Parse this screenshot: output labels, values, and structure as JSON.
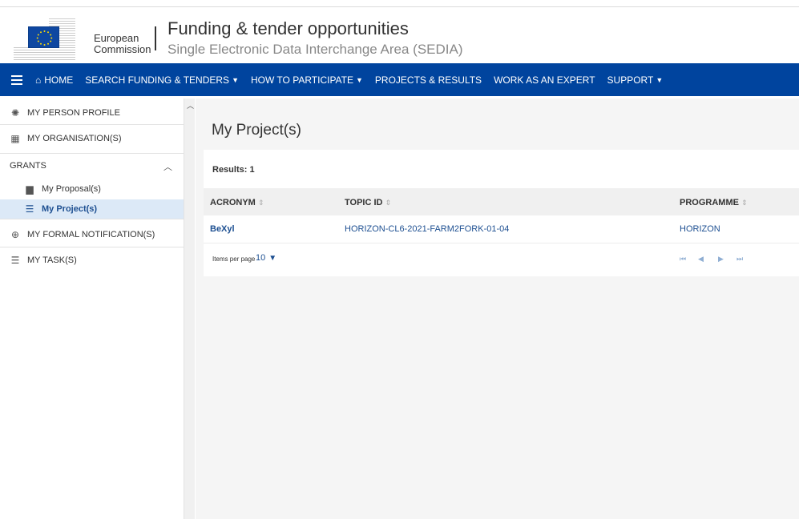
{
  "header": {
    "brand_line1": "European",
    "brand_line2": "Commission",
    "title": "Funding & tender opportunities",
    "subtitle": "Single Electronic Data Interchange Area (SEDIA)"
  },
  "nav": {
    "items": [
      {
        "label": "HOME"
      },
      {
        "label": "SEARCH FUNDING & TENDERS"
      },
      {
        "label": "HOW TO PARTICIPATE"
      },
      {
        "label": "PROJECTS & RESULTS"
      },
      {
        "label": "WORK AS AN EXPERT"
      },
      {
        "label": "SUPPORT"
      }
    ]
  },
  "sidebar": {
    "person_profile": "MY PERSON PROFILE",
    "organisations": "MY ORGANISATION(S)",
    "grants": "GRANTS",
    "proposals": "My Proposal(s)",
    "projects": "My Project(s)",
    "formal_notifications": "MY FORMAL NOTIFICATION(S)",
    "tasks": "MY TASK(S)"
  },
  "main": {
    "page_title": "My Project(s)",
    "results": "Results: 1",
    "columns": {
      "acronym": "ACRONYM",
      "topic_id": "TOPIC ID",
      "programme": "PROGRAMME"
    },
    "rows": [
      {
        "acronym": "BeXyl",
        "topic_id": "HORIZON-CL6-2021-FARM2FORK-01-04",
        "programme": "HORIZON"
      }
    ],
    "items_per_page_label": "Items per page",
    "items_per_page_value": "10"
  },
  "colors": {
    "nav_bg": "#00449e",
    "link": "#1d4f91",
    "selected_bg": "#dce9f7"
  }
}
